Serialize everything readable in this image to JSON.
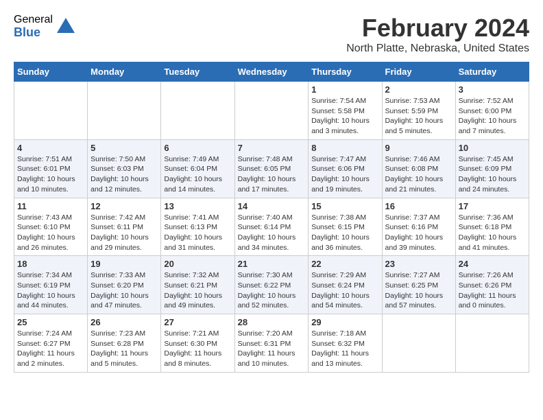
{
  "logo": {
    "general": "General",
    "blue": "Blue"
  },
  "title": {
    "month": "February 2024",
    "location": "North Platte, Nebraska, United States"
  },
  "weekdays": [
    "Sunday",
    "Monday",
    "Tuesday",
    "Wednesday",
    "Thursday",
    "Friday",
    "Saturday"
  ],
  "weeks": [
    [
      {
        "day": "",
        "info": ""
      },
      {
        "day": "",
        "info": ""
      },
      {
        "day": "",
        "info": ""
      },
      {
        "day": "",
        "info": ""
      },
      {
        "day": "1",
        "info": "Sunrise: 7:54 AM\nSunset: 5:58 PM\nDaylight: 10 hours and 3 minutes."
      },
      {
        "day": "2",
        "info": "Sunrise: 7:53 AM\nSunset: 5:59 PM\nDaylight: 10 hours and 5 minutes."
      },
      {
        "day": "3",
        "info": "Sunrise: 7:52 AM\nSunset: 6:00 PM\nDaylight: 10 hours and 7 minutes."
      }
    ],
    [
      {
        "day": "4",
        "info": "Sunrise: 7:51 AM\nSunset: 6:01 PM\nDaylight: 10 hours and 10 minutes."
      },
      {
        "day": "5",
        "info": "Sunrise: 7:50 AM\nSunset: 6:03 PM\nDaylight: 10 hours and 12 minutes."
      },
      {
        "day": "6",
        "info": "Sunrise: 7:49 AM\nSunset: 6:04 PM\nDaylight: 10 hours and 14 minutes."
      },
      {
        "day": "7",
        "info": "Sunrise: 7:48 AM\nSunset: 6:05 PM\nDaylight: 10 hours and 17 minutes."
      },
      {
        "day": "8",
        "info": "Sunrise: 7:47 AM\nSunset: 6:06 PM\nDaylight: 10 hours and 19 minutes."
      },
      {
        "day": "9",
        "info": "Sunrise: 7:46 AM\nSunset: 6:08 PM\nDaylight: 10 hours and 21 minutes."
      },
      {
        "day": "10",
        "info": "Sunrise: 7:45 AM\nSunset: 6:09 PM\nDaylight: 10 hours and 24 minutes."
      }
    ],
    [
      {
        "day": "11",
        "info": "Sunrise: 7:43 AM\nSunset: 6:10 PM\nDaylight: 10 hours and 26 minutes."
      },
      {
        "day": "12",
        "info": "Sunrise: 7:42 AM\nSunset: 6:11 PM\nDaylight: 10 hours and 29 minutes."
      },
      {
        "day": "13",
        "info": "Sunrise: 7:41 AM\nSunset: 6:13 PM\nDaylight: 10 hours and 31 minutes."
      },
      {
        "day": "14",
        "info": "Sunrise: 7:40 AM\nSunset: 6:14 PM\nDaylight: 10 hours and 34 minutes."
      },
      {
        "day": "15",
        "info": "Sunrise: 7:38 AM\nSunset: 6:15 PM\nDaylight: 10 hours and 36 minutes."
      },
      {
        "day": "16",
        "info": "Sunrise: 7:37 AM\nSunset: 6:16 PM\nDaylight: 10 hours and 39 minutes."
      },
      {
        "day": "17",
        "info": "Sunrise: 7:36 AM\nSunset: 6:18 PM\nDaylight: 10 hours and 41 minutes."
      }
    ],
    [
      {
        "day": "18",
        "info": "Sunrise: 7:34 AM\nSunset: 6:19 PM\nDaylight: 10 hours and 44 minutes."
      },
      {
        "day": "19",
        "info": "Sunrise: 7:33 AM\nSunset: 6:20 PM\nDaylight: 10 hours and 47 minutes."
      },
      {
        "day": "20",
        "info": "Sunrise: 7:32 AM\nSunset: 6:21 PM\nDaylight: 10 hours and 49 minutes."
      },
      {
        "day": "21",
        "info": "Sunrise: 7:30 AM\nSunset: 6:22 PM\nDaylight: 10 hours and 52 minutes."
      },
      {
        "day": "22",
        "info": "Sunrise: 7:29 AM\nSunset: 6:24 PM\nDaylight: 10 hours and 54 minutes."
      },
      {
        "day": "23",
        "info": "Sunrise: 7:27 AM\nSunset: 6:25 PM\nDaylight: 10 hours and 57 minutes."
      },
      {
        "day": "24",
        "info": "Sunrise: 7:26 AM\nSunset: 6:26 PM\nDaylight: 11 hours and 0 minutes."
      }
    ],
    [
      {
        "day": "25",
        "info": "Sunrise: 7:24 AM\nSunset: 6:27 PM\nDaylight: 11 hours and 2 minutes."
      },
      {
        "day": "26",
        "info": "Sunrise: 7:23 AM\nSunset: 6:28 PM\nDaylight: 11 hours and 5 minutes."
      },
      {
        "day": "27",
        "info": "Sunrise: 7:21 AM\nSunset: 6:30 PM\nDaylight: 11 hours and 8 minutes."
      },
      {
        "day": "28",
        "info": "Sunrise: 7:20 AM\nSunset: 6:31 PM\nDaylight: 11 hours and 10 minutes."
      },
      {
        "day": "29",
        "info": "Sunrise: 7:18 AM\nSunset: 6:32 PM\nDaylight: 11 hours and 13 minutes."
      },
      {
        "day": "",
        "info": ""
      },
      {
        "day": "",
        "info": ""
      }
    ]
  ]
}
